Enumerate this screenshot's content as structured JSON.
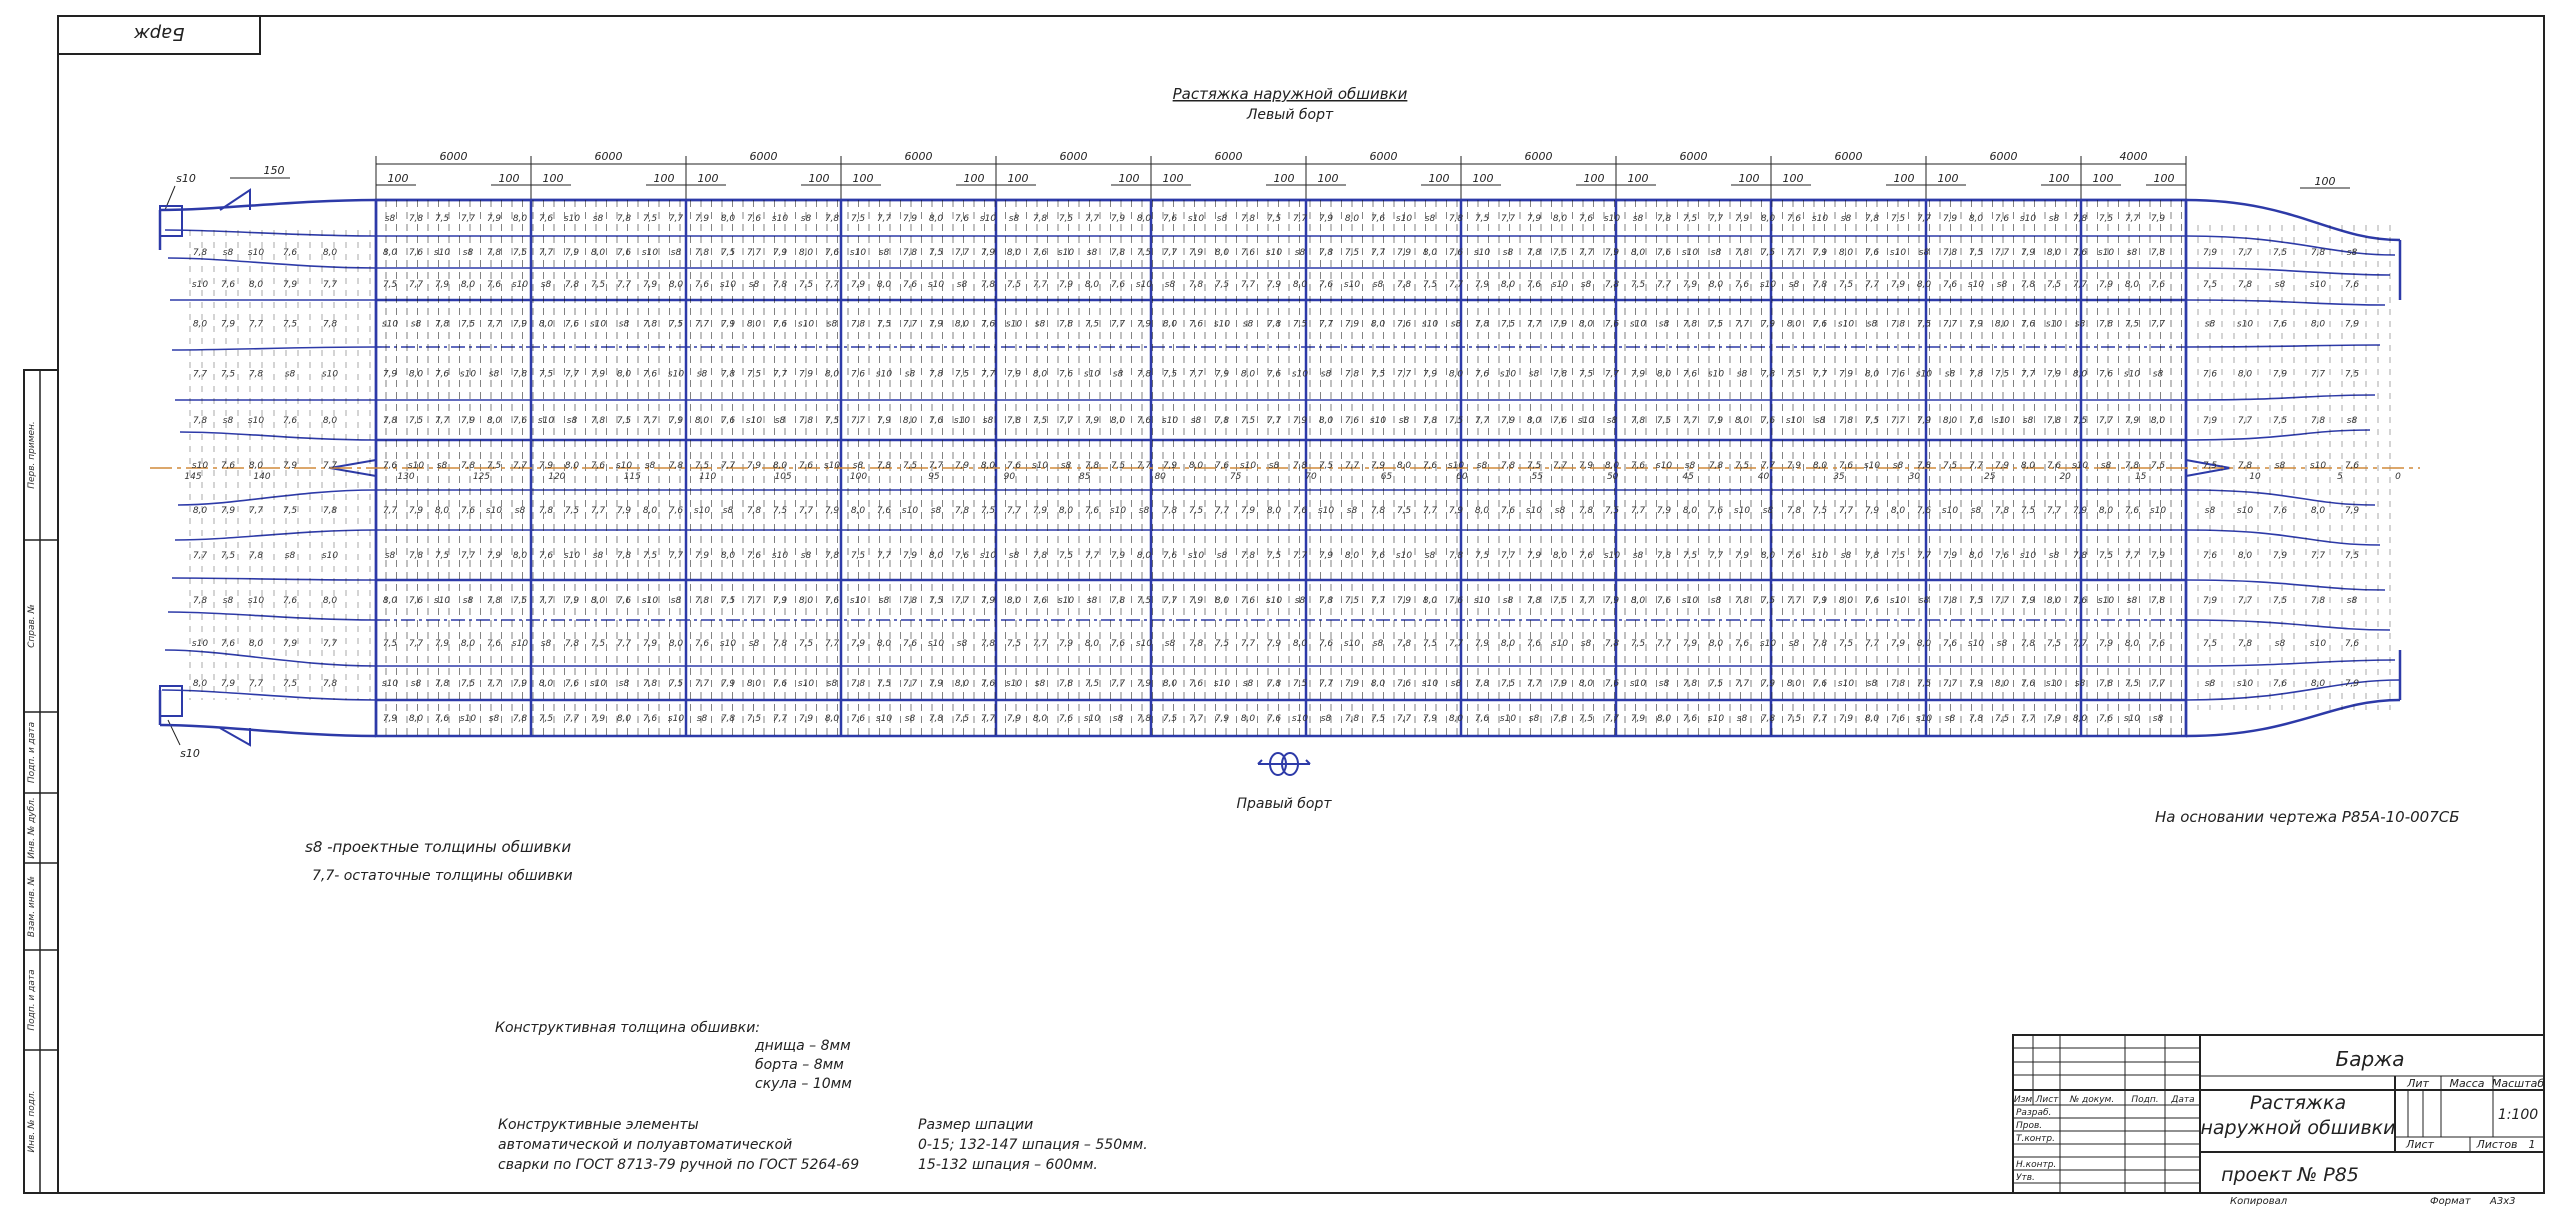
{
  "sheet": {
    "stamp": "Барж",
    "title_top": "Растяжка наружной обшивки",
    "subtitle_top": "Левый борт",
    "bottom_side": "Правый борт",
    "basis_note": "На основании чертежа Р85А-10-007СБ",
    "legend": {
      "s8_text": "s8 -проектные толщины обшивки",
      "residual_text": "7,7- остаточные толщины обшивки"
    },
    "constr_thickness": {
      "title": "Конструктивная толщина обшивки:",
      "lines": [
        "днища – 8мм",
        "борта – 8мм",
        "скула – 10мм"
      ]
    },
    "welding": {
      "lines": [
        "Конструктивные элементы",
        "автоматической и полуавтоматической",
        "сварки по ГОСТ 8713-79 ручной по ГОСТ 5264-69"
      ]
    },
    "spacing": {
      "lines": [
        "Размер шпации",
        "0-15; 132-147 шпация – 550мм.",
        "15-132 шпация – 600мм."
      ]
    }
  },
  "dimensions": {
    "section_lengths": [
      "6000",
      "6000",
      "6000",
      "6000",
      "6000",
      "6000",
      "6000",
      "6000",
      "6000",
      "6000",
      "6000",
      "4000"
    ],
    "sub_mark": "100",
    "left_top": "s10",
    "left_150": "150",
    "left_bottom": "s10"
  },
  "frames": {
    "left_numbers": [
      "145",
      "140"
    ],
    "center_numbers": [
      "130",
      "125",
      "120",
      "115",
      "110",
      "105",
      "100",
      "95",
      "90",
      "85",
      "80",
      "75",
      "70",
      "65",
      "60",
      "55",
      "50",
      "45",
      "40",
      "35",
      "30",
      "25",
      "20",
      "15"
    ],
    "right_numbers": [
      "10",
      "5",
      "0"
    ]
  },
  "plate_labels": [
    "s8",
    "7,7",
    "7,6",
    "7,8",
    "7,9",
    "s10",
    "7,5",
    "8,0"
  ],
  "side_stamp": [
    "Перв. примен.",
    "Справ. №",
    "Подп. и дата",
    "Инв. № дубл.",
    "Взам. инв. №",
    "Подп. и дата",
    "Инв. № подл."
  ],
  "title_block": {
    "name": "Баржа",
    "doc_title_1": "Растяжка",
    "doc_title_2": "наружной обшивки",
    "project": "проект № Р85",
    "lit": "Лит",
    "mass": "Масса",
    "scale_label": "Масштаб",
    "scale": "1:100",
    "sheet": "Лист",
    "sheets": "Листов",
    "sheets_value": "1",
    "header_cells": [
      "Изм",
      "Лист",
      "№ докум.",
      "Подп.",
      "Дата"
    ],
    "roles": [
      "Разраб.",
      "Пров.",
      "Т.контр.",
      "",
      "Н.контр.",
      "Утв."
    ],
    "copied": "Копировал",
    "format_label": "Формат",
    "format_value": "А3х3"
  },
  "colors": {
    "hull": "#2d3aa8",
    "frame": "#111111",
    "centerline": "#d08a3a",
    "text": "#222222"
  }
}
